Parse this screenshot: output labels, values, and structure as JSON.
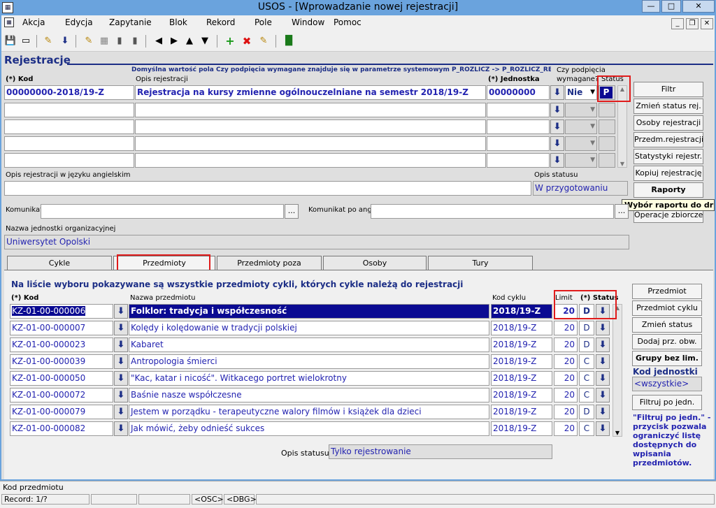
{
  "window": {
    "title": "USOS - [Wprowadzanie nowej rejestracji]"
  },
  "menu": {
    "items": [
      "Akcja",
      "Edycja",
      "Zapytanie",
      "Blok",
      "Rekord",
      "Pole",
      "Window",
      "Pomoc"
    ]
  },
  "header": {
    "title": "Rejestracje",
    "note": "Domyślna wartość pola Czy podpięcia wymagane znajduje się w parametrze systemowym  P_ROZLICZ -> P_ROZLICZ_REJ_PODP --->",
    "col_kod": "(*) Kod",
    "col_opis": "Opis rejestracji",
    "col_jedn": "(*) Jednostka",
    "col_podp1": "Czy podpięcia",
    "col_podp2": "wymagane?",
    "col_status": "Status"
  },
  "registration": {
    "kod": "00000000-2018/19-Z",
    "opis": "Rejestracja na kursy zmienne ogólnouczelniane na semestr 2018/19-Z",
    "jednostka": "00000000",
    "podpiecia": "Nie",
    "status": "P"
  },
  "fields": {
    "opis_ang_label": "Opis rejestracji w języku angielskim",
    "opis_ang_value": "",
    "opis_statusu_label": "Opis statusu",
    "opis_statusu_value": "W przygotowaniu",
    "komunikat_label": "Komunikat",
    "komunikat_value": "",
    "komunikat_ang_label": "Komunikat po ang.",
    "komunikat_ang_value": "",
    "jednostka_label": "Nazwa jednostki organizacyjnej",
    "jednostka_value": "Uniwersytet Opolski",
    "ellipsis": "..."
  },
  "right_buttons": [
    "Filtr",
    "Zmień status rej.",
    "Osoby rejestracji",
    "Przedm.rejestracji",
    "Statystyki rejestr.",
    "Kopiuj rejestrację",
    "Raporty",
    "Operacje zbiorcze"
  ],
  "tooltip": "Wybór raportu do druku",
  "tabs": [
    "Cykle",
    "Przedmioty",
    "Przedmioty poza rejestracją",
    "Osoby",
    "Tury"
  ],
  "subjects": {
    "info": "Na liście wyboru pokazywane są wszystkie przedmioty cykli, których cykle należą do rejestracji",
    "col_kod": "(*) Kod",
    "col_nazwa": "Nazwa przedmiotu",
    "col_cykl": "Kod cyklu",
    "col_limit": "Limit",
    "col_status": "(*) Status",
    "rows": [
      {
        "kod": "KZ-01-00-000006",
        "nazwa": "Folklor: tradycja i współczesność",
        "cykl": "2018/19-Z",
        "limit": "20",
        "status": "D"
      },
      {
        "kod": "KZ-01-00-000007",
        "nazwa": "Kolędy i kolędowanie w tradycji polskiej",
        "cykl": "2018/19-Z",
        "limit": "20",
        "status": "D"
      },
      {
        "kod": "KZ-01-00-000023",
        "nazwa": "Kabaret",
        "cykl": "2018/19-Z",
        "limit": "20",
        "status": "D"
      },
      {
        "kod": "KZ-01-00-000039",
        "nazwa": "Antropologia śmierci",
        "cykl": "2018/19-Z",
        "limit": "20",
        "status": "C"
      },
      {
        "kod": "KZ-01-00-000050",
        "nazwa": "\"Kac, katar i nicość\". Witkacego portret wielokrotny",
        "cykl": "2018/19-Z",
        "limit": "20",
        "status": "C"
      },
      {
        "kod": "KZ-01-00-000072",
        "nazwa": "Baśnie nasze współczesne",
        "cykl": "2018/19-Z",
        "limit": "20",
        "status": "C"
      },
      {
        "kod": "KZ-01-00-000079",
        "nazwa": "Jestem w porządku - terapeutyczne walory filmów i książek dla dzieci",
        "cykl": "2018/19-Z",
        "limit": "20",
        "status": "D"
      },
      {
        "kod": "KZ-01-00-000082",
        "nazwa": "Jak mówić, żeby odnieść sukces",
        "cykl": "2018/19-Z",
        "limit": "20",
        "status": "C"
      }
    ],
    "opis_statusu_label": "Opis statusu",
    "opis_statusu_value": "Tylko rejestrowanie"
  },
  "subject_buttons": [
    "Przedmiot",
    "Przedmiot cyklu",
    "Zmień status",
    "Dodaj prz. obw.",
    "Grupy bez lim."
  ],
  "kod_jednostki": {
    "label": "Kod jednostki",
    "value": "<wszystkie>",
    "filter_button": "Filtruj po jedn."
  },
  "filter_help": [
    "\"Filtruj po jedn.\" -",
    "przycisk pozwala",
    "ograniczyć listę",
    "dostępnych do",
    "wpisania",
    "przedmiotów."
  ],
  "statusbar": {
    "hint": "Kod przedmiotu",
    "record": "Record: 1/?",
    "osc": "<OSC>",
    "dbg": "<DBG>"
  },
  "colors": {
    "accent": "#1c2e86",
    "selected": "#0a0a92",
    "highlight": "#e01b1b",
    "title_bar": "#6aa3dd"
  }
}
